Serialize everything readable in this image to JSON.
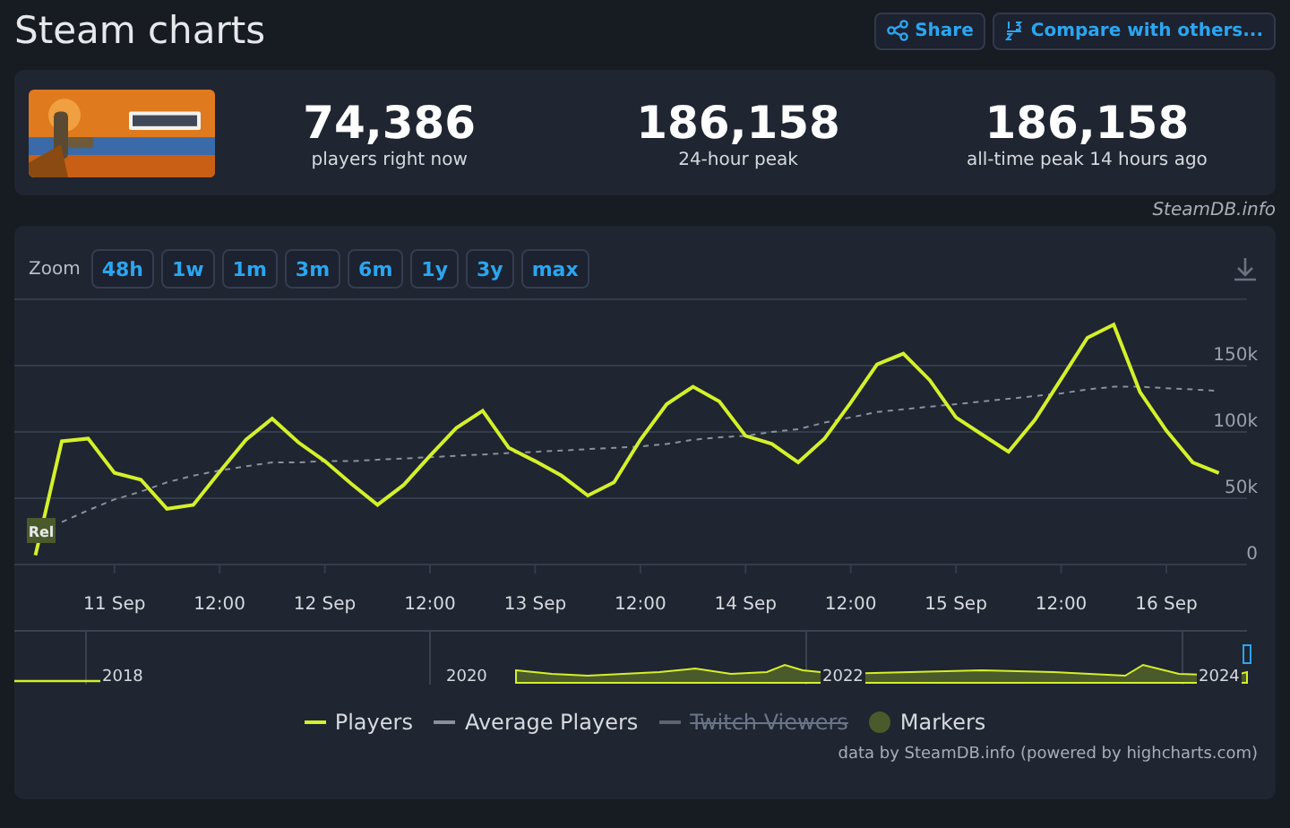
{
  "header": {
    "title": "Steam charts",
    "buttons": [
      {
        "kind": "share",
        "label": "Share"
      },
      {
        "kind": "compare",
        "label": "Compare with others..."
      }
    ]
  },
  "summary": {
    "stats": [
      {
        "value": "74,386",
        "label": "players right now"
      },
      {
        "value": "186,158",
        "label": "24-hour peak"
      },
      {
        "value": "186,158",
        "label": "all-time peak 14 hours ago"
      }
    ],
    "credit": "SteamDB.info"
  },
  "chart": {
    "zoom_label": "Zoom",
    "zoom_buttons": [
      "48h",
      "1w",
      "1m",
      "3m",
      "6m",
      "1y",
      "3y",
      "max"
    ],
    "release_flag": "Rel",
    "chart_data": {
      "type": "line",
      "grid": true,
      "ylim": [
        0,
        200000
      ],
      "categories": [
        null,
        null,
        null,
        "11 Sep",
        null,
        null,
        null,
        "12:00",
        null,
        null,
        null,
        "12 Sep",
        null,
        null,
        null,
        "12:00",
        null,
        null,
        null,
        "13 Sep",
        null,
        null,
        null,
        "12:00",
        null,
        null,
        null,
        "14 Sep",
        null,
        null,
        null,
        "12:00",
        null,
        null,
        null,
        "15 Sep",
        null,
        null,
        null,
        "12:00",
        null,
        null,
        null,
        "16 Sep",
        null,
        null
      ],
      "yticks": [
        {
          "value": 0,
          "label": "0"
        },
        {
          "value": 50000,
          "label": "50k"
        },
        {
          "value": 100000,
          "label": "100k"
        },
        {
          "value": 150000,
          "label": "150k"
        }
      ],
      "series": [
        {
          "name": "Players",
          "color": "#d4f02a",
          "line_style": "solid",
          "values": [
            7000,
            93000,
            95000,
            69000,
            64000,
            42000,
            45000,
            70000,
            94000,
            110000,
            92000,
            78000,
            61000,
            45000,
            60000,
            82000,
            103000,
            116000,
            88000,
            78000,
            67000,
            52000,
            62000,
            94000,
            121000,
            134000,
            123000,
            97000,
            91000,
            77000,
            95000,
            122000,
            151000,
            159000,
            139000,
            111000,
            98000,
            85000,
            109000,
            140000,
            171000,
            181000,
            130000,
            101000,
            77000,
            69000
          ]
        },
        {
          "name": "Average Players",
          "color": "#8a919c",
          "line_style": "dashed",
          "values": [
            null,
            32000,
            41000,
            49000,
            55000,
            62000,
            67000,
            71000,
            74000,
            77000,
            77000,
            78000,
            78000,
            79000,
            80000,
            81000,
            82000,
            83000,
            84000,
            85000,
            86000,
            87000,
            88000,
            89000,
            91000,
            94000,
            96000,
            97000,
            100000,
            102000,
            107000,
            111000,
            115000,
            117000,
            119000,
            121000,
            123000,
            125000,
            127000,
            129000,
            132000,
            134000,
            134000,
            133000,
            132000,
            131000
          ]
        }
      ]
    },
    "navigator_years": [
      "2018",
      "2020",
      "2022",
      "2024"
    ],
    "legend": [
      {
        "kind": "series",
        "hidden": false
      },
      {
        "kind": "series",
        "hidden": false
      },
      {
        "kind": "line",
        "label": "Twitch Viewers",
        "color": "#5c6470",
        "hidden": true
      },
      {
        "kind": "dot",
        "label": "Markers",
        "color": "#4b5a2a",
        "hidden": false
      }
    ],
    "credits": "data by SteamDB.info (powered by highcharts.com)"
  }
}
